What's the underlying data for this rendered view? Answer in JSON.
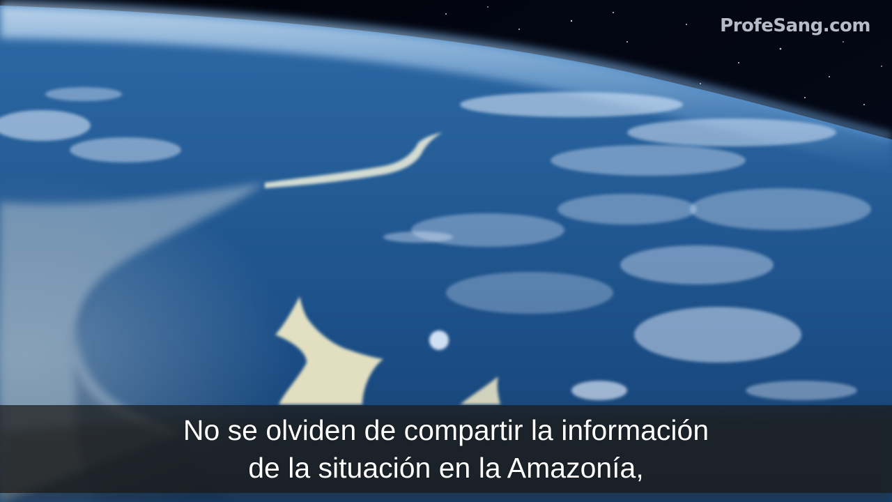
{
  "watermark": "ProfeSang.com",
  "subtitles": {
    "line1": "No se olviden de compartir la información",
    "line2": "de la situación en la Amazonía,"
  },
  "scene": {
    "description_icon": "earth-from-orbit-image",
    "colors": {
      "space": "#02040c",
      "ocean_deep": "#1d4f86",
      "ocean_light": "#3f7fb9",
      "atmosphere": "#bfe0ff",
      "clouds": "#e8f2ff",
      "silty_water": "#c9cdc2"
    }
  }
}
